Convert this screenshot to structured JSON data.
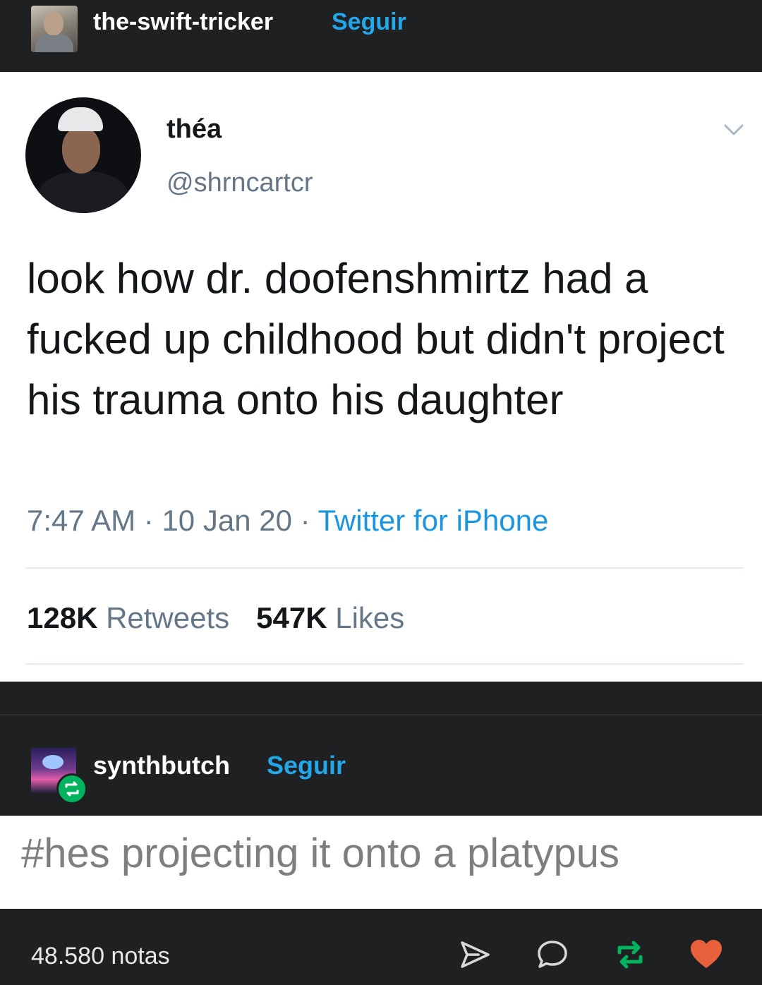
{
  "header": {
    "username": "the-swift-tricker",
    "follow_label": "Seguir"
  },
  "tweet": {
    "display_name": "théa",
    "handle": "@shrncartcr",
    "text": "look how dr. doofenshmirtz had a fucked up childhood but didn't project his trauma onto his daughter",
    "time": "7:47 AM",
    "date": "10 Jan 20",
    "separator": "·",
    "source": "Twitter for iPhone",
    "retweets_count": "128K",
    "retweets_label": "Retweets",
    "likes_count": "547K",
    "likes_label": "Likes"
  },
  "reblog": {
    "username": "synthbutch",
    "follow_label": "Seguir",
    "tag": "#hes projecting it onto a platypus"
  },
  "footer": {
    "notes": "48.580 notas"
  },
  "icons": {
    "share": "share-icon",
    "reply": "reply-icon",
    "reblog": "reblog-icon",
    "like": "heart-icon"
  },
  "colors": {
    "background": "#1f2022",
    "follow": "#23a7e8",
    "twitter_link": "#1b95e0",
    "reblog_green": "#00b35f",
    "like_red": "#e8613c"
  }
}
